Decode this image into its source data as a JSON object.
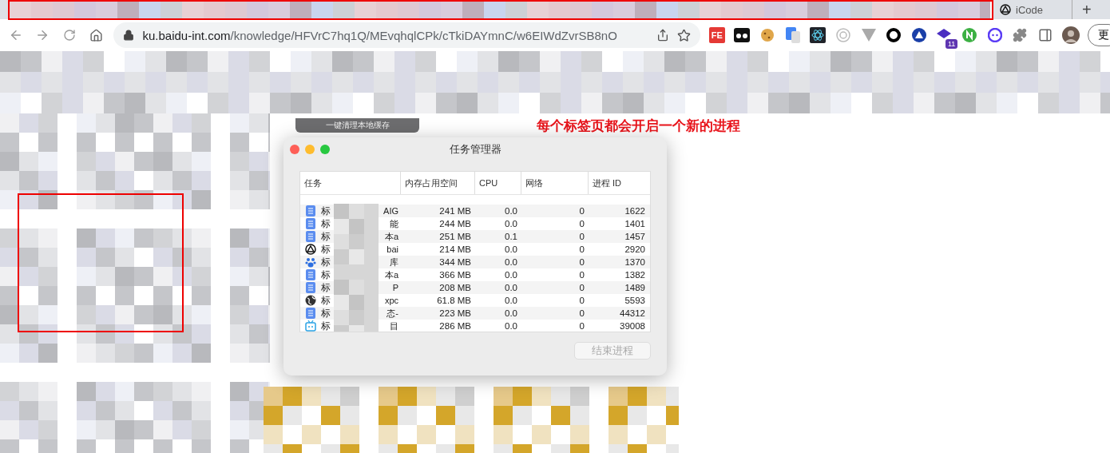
{
  "tab_strip": {
    "tabs": [
      {
        "selected": true
      },
      {
        "label": "iCode",
        "selected": false
      }
    ],
    "new_tab": "+"
  },
  "address_bar": {
    "host": "ku.baidu-int.com",
    "path": "/knowledge/HFVrC7hq1Q/MEvqhqlCPk/cTkiDAYmnC/w6EIWdZvrSB8nO",
    "extension_badge": "11",
    "fe_label": "FE",
    "update_button": "更"
  },
  "page": {
    "clear_cache_button": "一键清理本地缓存",
    "annotation": "每个标签页都会开启一个新的进程"
  },
  "task_manager": {
    "title": "任务管理器",
    "columns": [
      "任务",
      "内存占用空间",
      "CPU",
      "网络",
      "进程 ID"
    ],
    "rows": [
      {
        "kind": "doc",
        "task": "标",
        "task_tail": "AIG",
        "memory": "241 MB",
        "cpu": "0.0",
        "network": "0",
        "pid": "1622"
      },
      {
        "kind": "doc",
        "task": "标",
        "task_tail": "能",
        "memory": "244 MB",
        "cpu": "0.0",
        "network": "0",
        "pid": "1401"
      },
      {
        "kind": "doc",
        "task": "标",
        "task_tail": "本a",
        "memory": "251 MB",
        "cpu": "0.1",
        "network": "0",
        "pid": "1457"
      },
      {
        "kind": "icode",
        "task": "标",
        "task_tail": "bai",
        "memory": "214 MB",
        "cpu": "0.0",
        "network": "0",
        "pid": "2920"
      },
      {
        "kind": "paw",
        "task": "标",
        "task_tail": "库",
        "memory": "344 MB",
        "cpu": "0.0",
        "network": "0",
        "pid": "1370"
      },
      {
        "kind": "doc",
        "task": "标",
        "task_tail": "本a",
        "memory": "366 MB",
        "cpu": "0.0",
        "network": "0",
        "pid": "1382"
      },
      {
        "kind": "doc",
        "task": "标",
        "task_tail": "P",
        "memory": "208 MB",
        "cpu": "0.0",
        "network": "0",
        "pid": "1489"
      },
      {
        "kind": "globe",
        "task": "标",
        "task_tail": "xpc",
        "memory": "61.8 MB",
        "cpu": "0.0",
        "network": "0",
        "pid": "5593"
      },
      {
        "kind": "doc",
        "task": "标",
        "task_tail": "态-",
        "memory": "223 MB",
        "cpu": "0.0",
        "network": "0",
        "pid": "44312"
      },
      {
        "kind": "tv",
        "task": "标",
        "task_tail": "目",
        "memory": "286 MB",
        "cpu": "0.0",
        "network": "0",
        "pid": "39008"
      }
    ],
    "end_button": {
      "label": "结束进程",
      "disabled": true
    }
  }
}
